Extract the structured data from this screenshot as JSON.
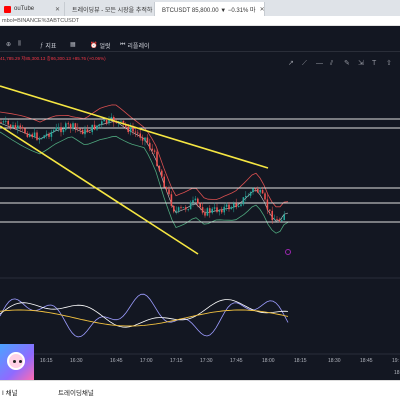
{
  "browser": {
    "tabs": [
      {
        "label": "ouTube",
        "icon": "youtube-icon",
        "color": "#ff0000"
      },
      {
        "label": "트레이딩뷰 - 모든 시장을 추적하",
        "icon": "tradingview-icon",
        "color": "#131722"
      },
      {
        "label": "BTCUSDT 85,800.00 ▼ −0.31% 마",
        "icon": "tradingview-icon",
        "color": "#131722"
      }
    ],
    "address": "mbol=BINANCE%3ABTCUSDT"
  },
  "toolbar": {
    "indicators_label": "지표",
    "alert_label": "얼럿",
    "replay_label": "리플레이"
  },
  "ohlc_text": "41,785.29 저85,300.13 종86,300.13 +85.76 (+0.06%)",
  "chart_data": {
    "type": "candlestick",
    "x_ticks": [
      "16:15",
      "16:30",
      "16:45",
      "17:00",
      "17:15",
      "17:30",
      "17:45",
      "18:00",
      "18:15",
      "18:30",
      "18:45"
    ],
    "horizontal_levels_count": 5,
    "trendlines": 3,
    "colors": {
      "up": "#26a69a",
      "down": "#ef5350",
      "bb": "#4ea67d",
      "trendline": "#f5e642",
      "osc1": "#ffffff",
      "osc2": "#9c9cff",
      "osc3": "#f0c040"
    }
  },
  "taskbar": {
    "item1": "I 채널",
    "item2": "트레이딩채널"
  },
  "right_edge_labels": [
    "19:",
    "18:"
  ]
}
